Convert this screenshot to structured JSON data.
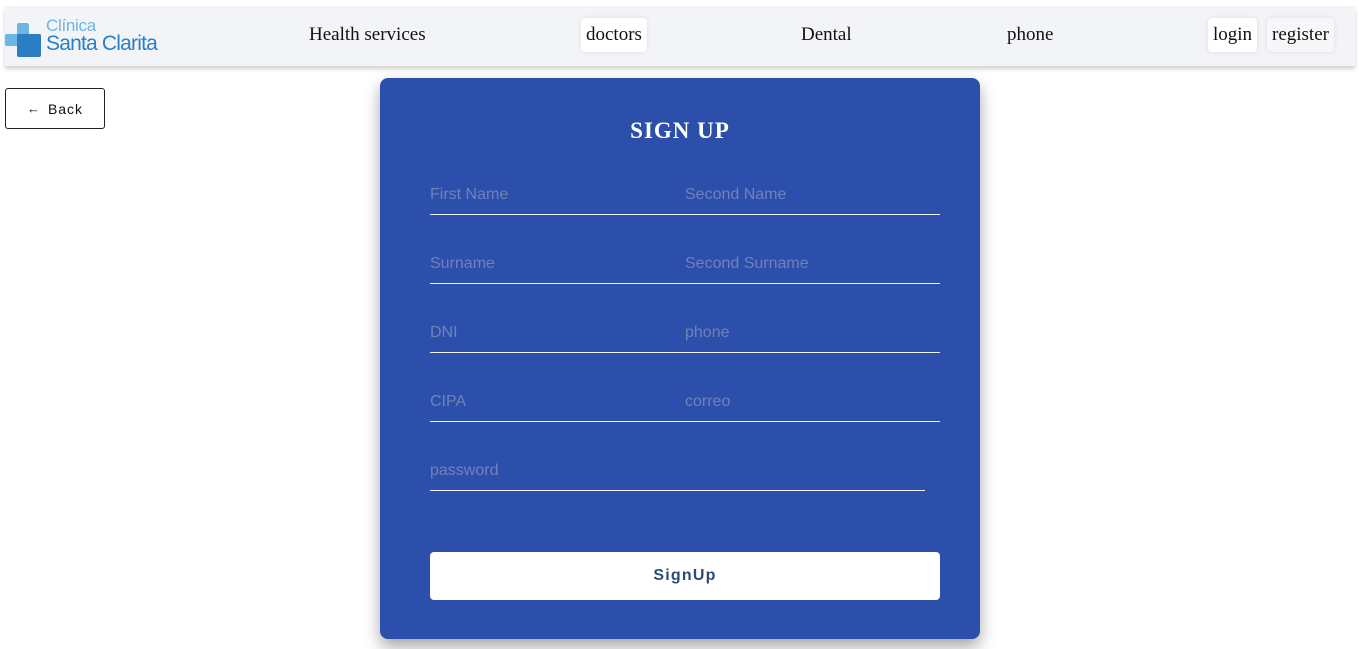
{
  "logo": {
    "line1": "Clínica",
    "line2": "Santa Clarita"
  },
  "nav": {
    "health_services": "Health services",
    "doctors": "doctors",
    "dental": "Dental",
    "phone": "phone",
    "login": "login",
    "register": "register"
  },
  "back": {
    "label": "Back"
  },
  "form": {
    "title": "SIGN UP",
    "first_name": {
      "placeholder": "First Name",
      "value": ""
    },
    "second_name": {
      "placeholder": "Second Name",
      "value": ""
    },
    "surname": {
      "placeholder": "Surname",
      "value": ""
    },
    "second_surname": {
      "placeholder": "Second Surname",
      "value": ""
    },
    "dni": {
      "placeholder": "DNI",
      "value": ""
    },
    "phone": {
      "placeholder": "phone",
      "value": ""
    },
    "cipa": {
      "placeholder": "CIPA",
      "value": ""
    },
    "correo": {
      "placeholder": "correo",
      "value": ""
    },
    "password": {
      "placeholder": "password",
      "value": ""
    },
    "submit_label": "SignUp"
  },
  "colors": {
    "card": "#2c4fab",
    "logo_light": "#6cb6e6",
    "logo_dark": "#2a7fc4",
    "button_text": "#2c4a78"
  },
  "icons": {
    "logo": "medical-cross-icon",
    "back": "arrow-left-icon"
  }
}
